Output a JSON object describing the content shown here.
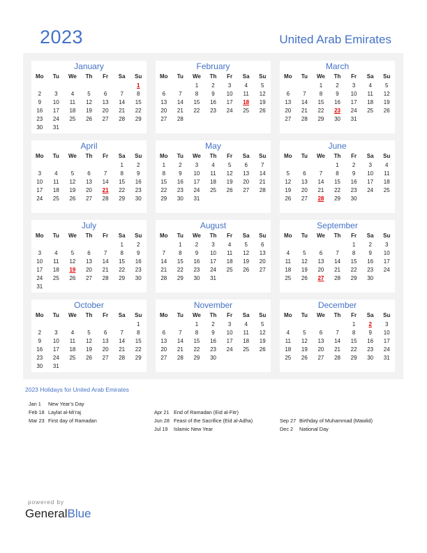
{
  "header": {
    "year": "2023",
    "country": "United Arab Emirates"
  },
  "weekdays": [
    "Mo",
    "Tu",
    "We",
    "Th",
    "Fr",
    "Sa",
    "Su"
  ],
  "colors": {
    "accent": "#4472c4",
    "holiday": "#e00000",
    "panel_bg": "#f2f2f2"
  },
  "months": [
    {
      "name": "January",
      "offset": 6,
      "days": 31,
      "holidays": [
        1
      ]
    },
    {
      "name": "February",
      "offset": 2,
      "days": 28,
      "holidays": [
        18
      ]
    },
    {
      "name": "March",
      "offset": 2,
      "days": 31,
      "holidays": [
        23
      ]
    },
    {
      "name": "April",
      "offset": 5,
      "days": 30,
      "holidays": [
        21
      ]
    },
    {
      "name": "May",
      "offset": 0,
      "days": 31,
      "holidays": []
    },
    {
      "name": "June",
      "offset": 3,
      "days": 30,
      "holidays": [
        28
      ]
    },
    {
      "name": "July",
      "offset": 5,
      "days": 31,
      "holidays": [
        19
      ]
    },
    {
      "name": "August",
      "offset": 1,
      "days": 31,
      "holidays": []
    },
    {
      "name": "September",
      "offset": 4,
      "days": 30,
      "holidays": [
        27
      ]
    },
    {
      "name": "October",
      "offset": 6,
      "days": 31,
      "holidays": []
    },
    {
      "name": "November",
      "offset": 2,
      "days": 30,
      "holidays": []
    },
    {
      "name": "December",
      "offset": 4,
      "days": 31,
      "holidays": [
        2
      ]
    }
  ],
  "holidays_section": {
    "title": "2023 Holidays for United Arab Emirates",
    "columns": [
      [
        {
          "date": "Jan 1",
          "name": "New Year’s Day"
        },
        {
          "date": "Feb 18",
          "name": "Laylat al-Mi’raj"
        },
        {
          "date": "Mar 23",
          "name": "First day of Ramadan"
        }
      ],
      [
        {
          "date": "Apr 21",
          "name": "End of Ramadan (Eid al-Fitr)"
        },
        {
          "date": "Jun 28",
          "name": "Feast of the Sacrifice (Eid al-Adha)"
        },
        {
          "date": "Jul 19",
          "name": "Islamic New Year"
        }
      ],
      [
        {
          "date": "Sep 27",
          "name": "Birthday of Muhammad (Mawlid)"
        },
        {
          "date": "Dec 2",
          "name": "National Day"
        }
      ]
    ]
  },
  "footer": {
    "powered_by": "powered by",
    "brand_part1": "General",
    "brand_part2": "Blue"
  }
}
